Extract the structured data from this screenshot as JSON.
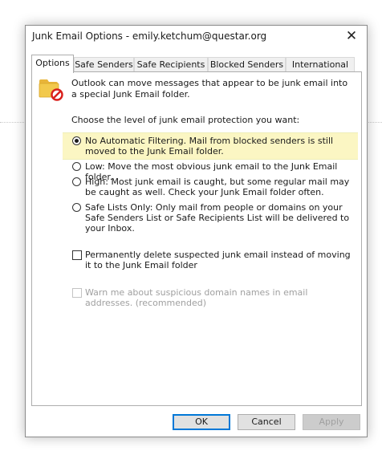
{
  "dialog": {
    "title": "Junk Email Options - emily.ketchum@questar.org",
    "close_glyph": "✕"
  },
  "tabs": [
    {
      "label": "Options",
      "active": true
    },
    {
      "label": "Safe Senders"
    },
    {
      "label": "Safe Recipients"
    },
    {
      "label": "Blocked Senders"
    },
    {
      "label": "International"
    }
  ],
  "panel": {
    "icon": "junk-folder-icon",
    "intro": "Outlook can move messages that appear to be junk email into a special Junk Email folder.",
    "choose": "Choose the level of junk email protection you want:",
    "options": [
      {
        "label": "No Automatic Filtering. Mail from blocked senders is still moved to the Junk Email folder.",
        "checked": true
      },
      {
        "label": "Low: Move the most obvious junk email to the Junk Email folder.",
        "checked": false
      },
      {
        "label": "High: Most junk email is caught, but some regular mail may be caught as well. Check your Junk Email folder often.",
        "checked": false
      },
      {
        "label": "Safe Lists Only: Only mail from people or domains on your Safe Senders List or Safe Recipients List will be delivered to your Inbox.",
        "checked": false
      }
    ],
    "delete_permanently": {
      "label": "Permanently delete suspected junk email instead of moving it to the Junk Email folder",
      "checked": false
    },
    "warn_domains": {
      "label": "Warn me about suspicious domain names in email addresses. (recommended)",
      "checked": false,
      "disabled": true
    }
  },
  "buttons": {
    "ok": "OK",
    "cancel": "Cancel",
    "apply": "Apply"
  },
  "colors": {
    "selected_option_bg": "#fbf6c3",
    "default_button_border": "#0078d7",
    "block_red": "#d9201c",
    "folder_yellow": "#f2c94c"
  }
}
